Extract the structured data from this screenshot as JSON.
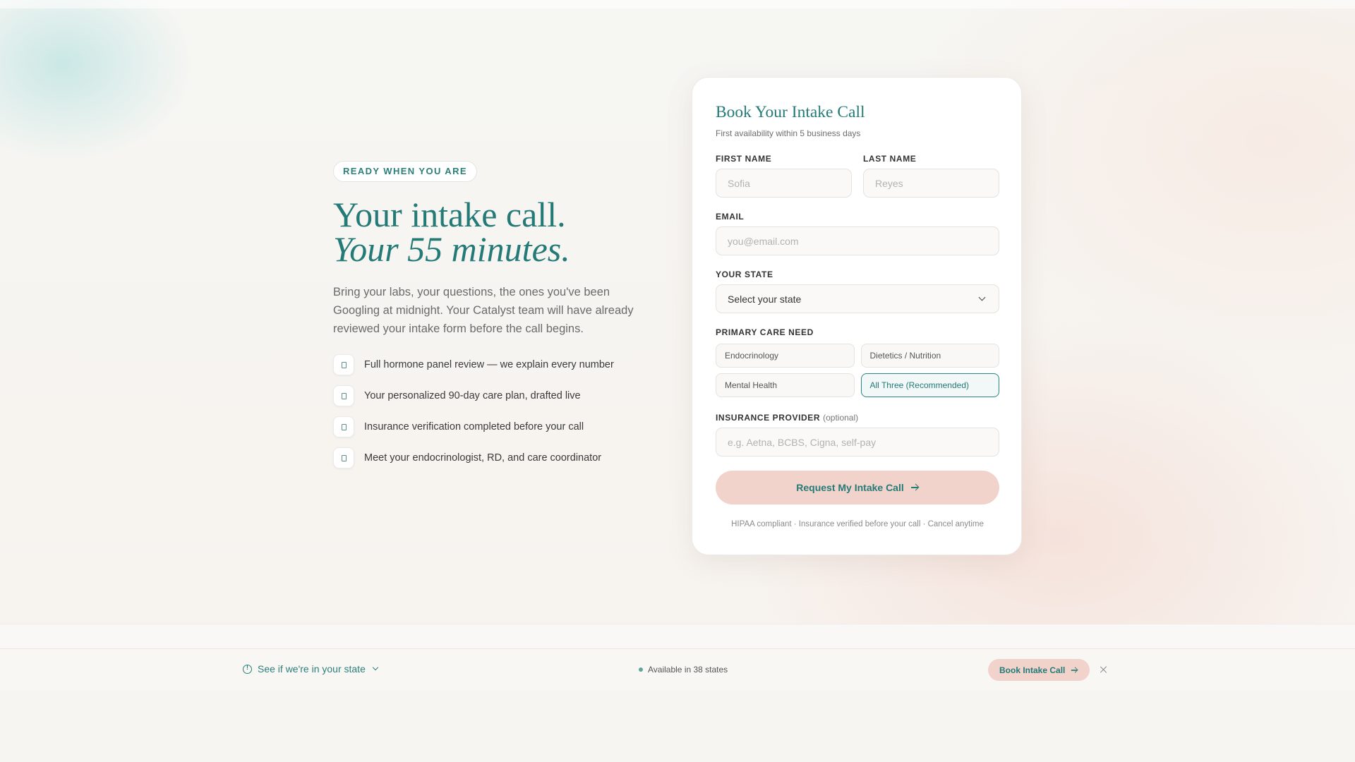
{
  "hero": {
    "eyebrow": "READY WHEN YOU ARE",
    "headline_line1": "Your intake call.",
    "headline_line2": "Your 55 minutes.",
    "lead": "Bring your labs, your questions, the ones you've been Googling at midnight. Your Catalyst team will have already reviewed your intake form before the call begins.",
    "features": [
      {
        "text": "Full hormone panel review — we explain every number",
        "icon": "document-icon"
      },
      {
        "text": "Your personalized 90-day care plan, drafted live",
        "icon": "document-icon"
      },
      {
        "text": "Insurance verification completed before your call",
        "icon": "document-icon"
      },
      {
        "text": "Meet your endocrinologist, RD, and care coordinator",
        "icon": "document-icon"
      }
    ]
  },
  "form": {
    "title": "Book Your Intake Call",
    "subtitle": "First availability within 5 business days",
    "first_name": {
      "label": "FIRST NAME",
      "placeholder": "Sofia",
      "value": ""
    },
    "last_name": {
      "label": "LAST NAME",
      "placeholder": "Reyes",
      "value": ""
    },
    "email": {
      "label": "EMAIL",
      "placeholder": "you@email.com",
      "value": ""
    },
    "state": {
      "label": "YOUR STATE",
      "selected": "Select your state"
    },
    "care_need": {
      "label": "PRIMARY CARE NEED",
      "options": [
        {
          "label": "Endocrinology",
          "selected": false
        },
        {
          "label": "Dietetics / Nutrition",
          "selected": false
        },
        {
          "label": "Mental Health",
          "selected": false
        },
        {
          "label": "All Three (Recommended)",
          "selected": true
        }
      ]
    },
    "insurance": {
      "label": "INSURANCE PROVIDER",
      "optional": "(optional)",
      "placeholder": "e.g. Aetna, BCBS, Cigna, self-pay",
      "value": ""
    },
    "submit_label": "Request My Intake Call",
    "fine_print": "HIPAA compliant · Insurance verified before your call · Cancel anytime"
  },
  "sticky_bar": {
    "state_check_label": "See if we're in your state",
    "availability": "Available in 38 states",
    "book_label": "Book Intake Call"
  },
  "colors": {
    "accent": "#237a77",
    "cta_background": "#f2d3cc",
    "page_background": "#f7f5f2"
  }
}
